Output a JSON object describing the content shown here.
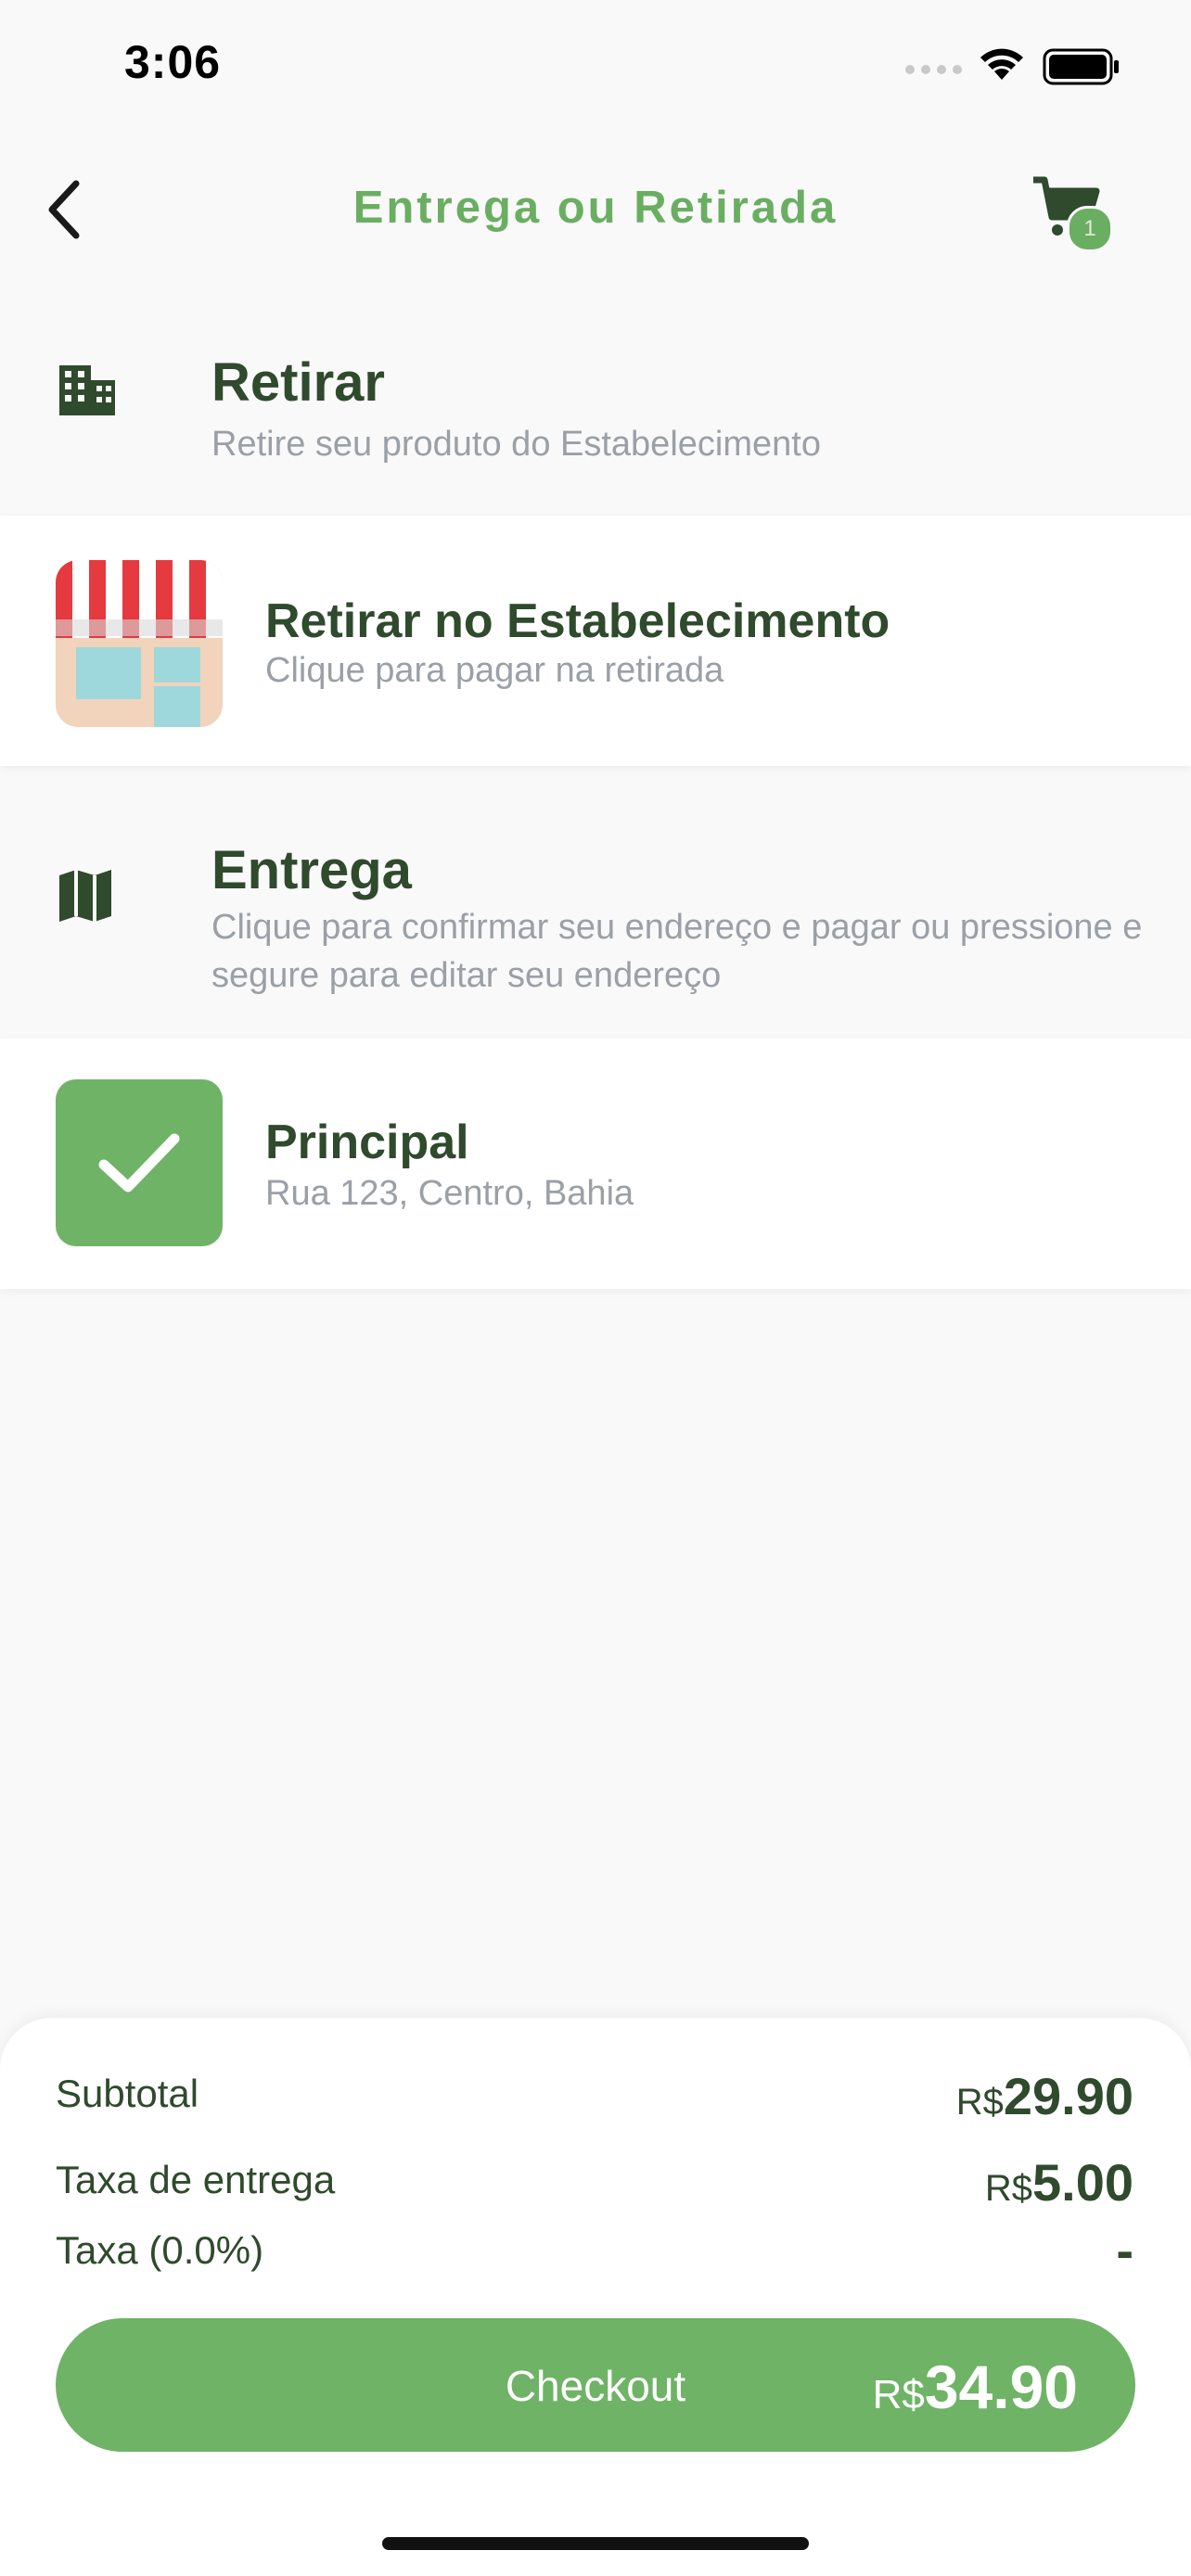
{
  "status_bar": {
    "time": "3:06"
  },
  "header": {
    "title": "Entrega ou Retirada",
    "cart_badge": "1"
  },
  "pickup": {
    "title": "Retirar",
    "subtitle": "Retire seu produto do Estabelecimento",
    "option": {
      "title": "Retirar no Estabelecimento",
      "subtitle": "Clique para pagar na retirada"
    }
  },
  "delivery": {
    "title": "Entrega",
    "subtitle": "Clique para confirmar seu endereço e pagar ou pressione e segure para editar seu endereço",
    "option": {
      "title": "Principal",
      "subtitle": "Rua 123, Centro, Bahia"
    }
  },
  "summary": {
    "currency": "R$",
    "subtotal_label": "Subtotal",
    "subtotal_value": "29.90",
    "delivery_fee_label": "Taxa de entrega",
    "delivery_fee_value": "5.00",
    "tax_label": "Taxa (0.0%)",
    "tax_value": "-"
  },
  "checkout": {
    "label": "Checkout",
    "currency": "R$",
    "total": "34.90"
  },
  "colors": {
    "accent": "#6fb366",
    "dark_green": "#2f4a2c",
    "muted": "#9aa0a6"
  }
}
